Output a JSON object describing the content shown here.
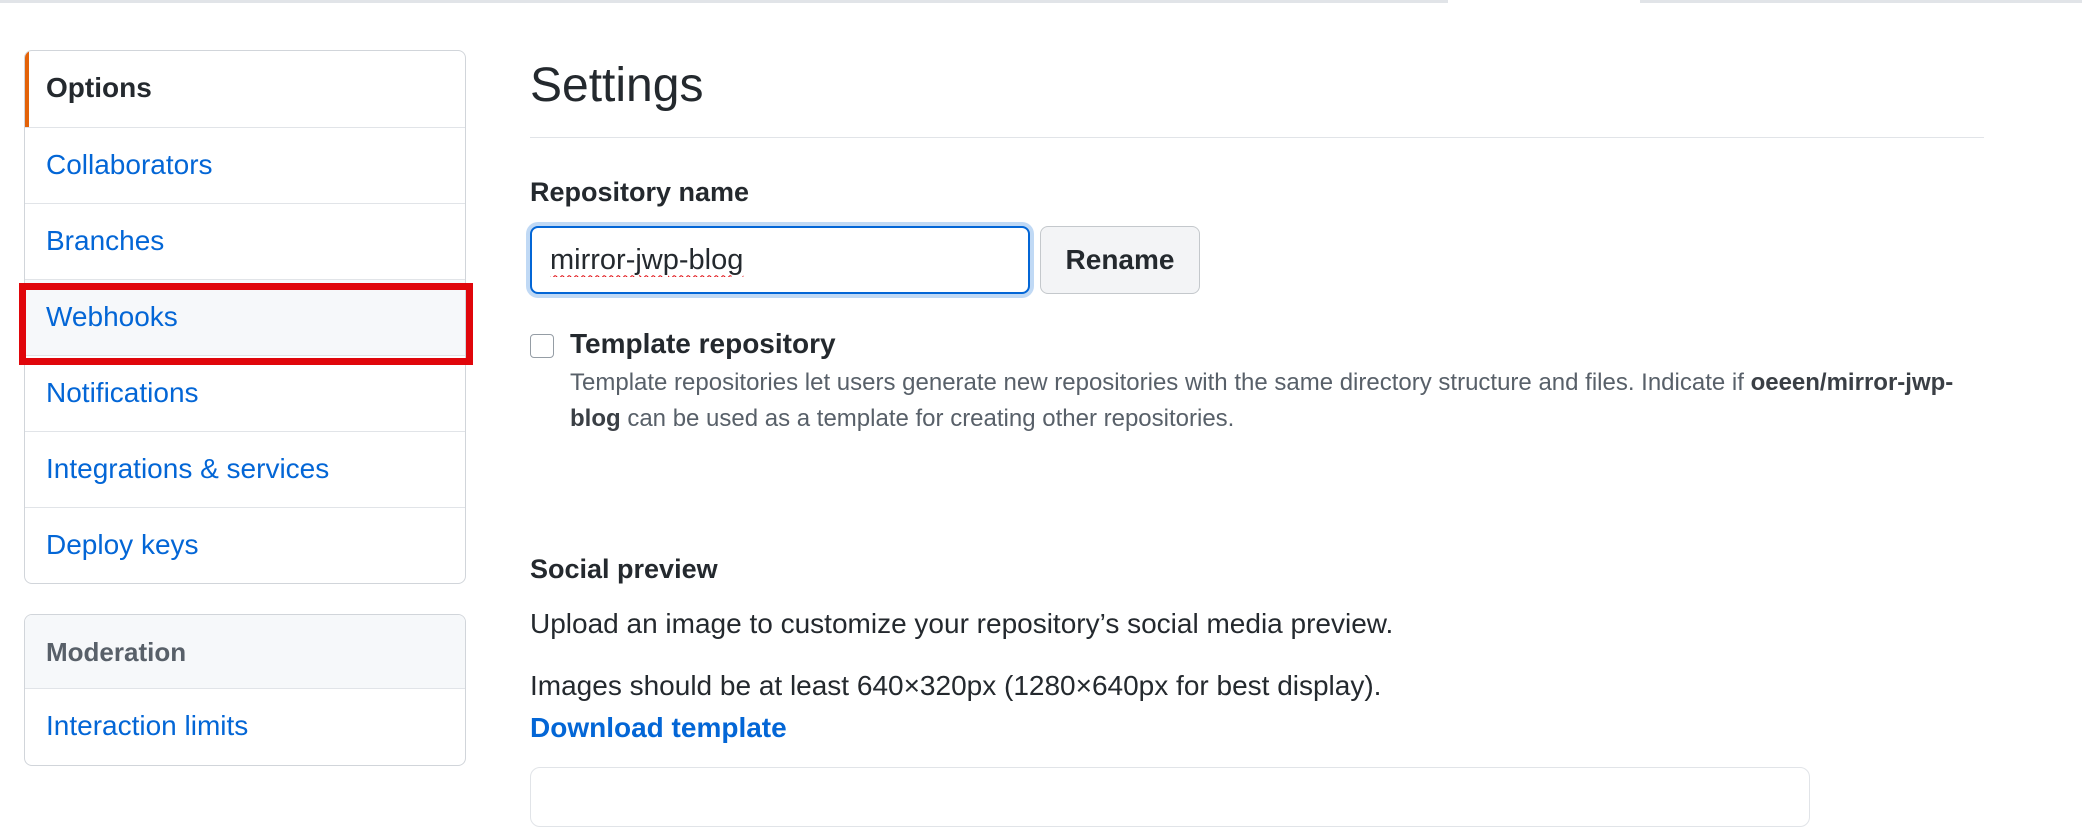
{
  "sidebar": {
    "items": [
      {
        "label": "Options"
      },
      {
        "label": "Collaborators"
      },
      {
        "label": "Branches"
      },
      {
        "label": "Webhooks"
      },
      {
        "label": "Notifications"
      },
      {
        "label": "Integrations & services"
      },
      {
        "label": "Deploy keys"
      }
    ],
    "moderation": {
      "heading": "Moderation",
      "items": [
        {
          "label": "Interaction limits"
        }
      ]
    }
  },
  "main": {
    "title": "Settings",
    "repo_name": {
      "label": "Repository name",
      "value": "mirror-jwp-blog",
      "rename_label": "Rename"
    },
    "template": {
      "label": "Template repository",
      "desc_part1": "Template repositories let users generate new repositories with the same directory structure and files. Indicate if ",
      "repo_full_name": "oeeen/mirror-jwp-blog",
      "desc_part2": " can be used as a template for creating other repositories.",
      "checked": false
    },
    "social": {
      "title": "Social preview",
      "para1": "Upload an image to customize your repository’s social media preview.",
      "para2": "Images should be at least 640×320px (1280×640px for best display).",
      "download_label": "Download template"
    }
  },
  "colors": {
    "accent_link": "#0366d6",
    "selected_marker": "#e36209",
    "highlight": "#e0060b"
  }
}
